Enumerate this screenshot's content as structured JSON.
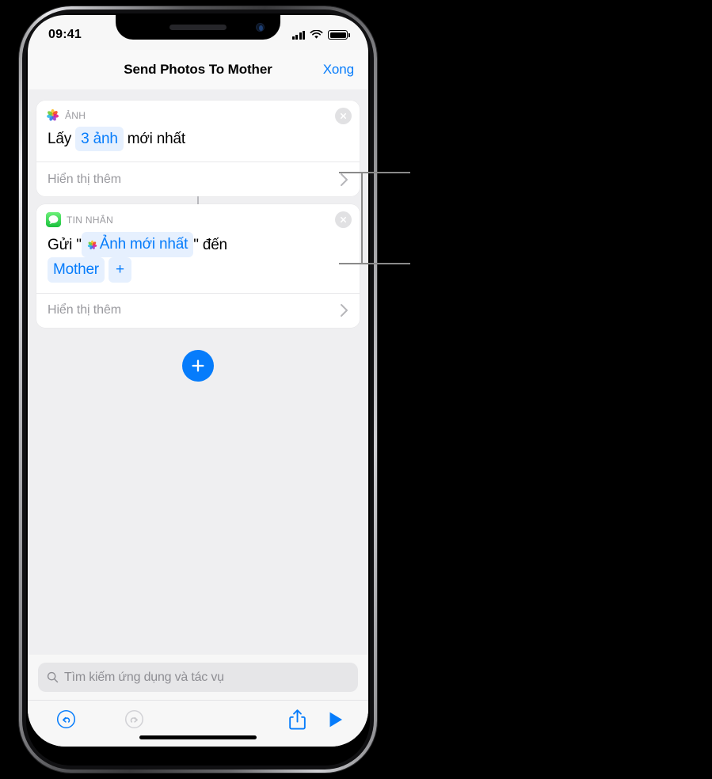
{
  "status_bar": {
    "time": "09:41",
    "signal_icon": "cellular-bars-icon",
    "wifi_icon": "wifi-icon",
    "battery_icon": "battery-icon"
  },
  "nav_bar": {
    "title": "Send Photos To Mother",
    "done_label": "Xong"
  },
  "shortcut": {
    "actions": [
      {
        "app_name": "ẢNH",
        "app_icon": "photos-icon",
        "close_icon": "close-circle-icon",
        "phrase_parts": [
          {
            "type": "text",
            "value": "Lấy"
          },
          {
            "type": "token",
            "value": "3 ảnh"
          },
          {
            "type": "text",
            "value": "mới nhất"
          }
        ],
        "show_more_label": "Hiển thị thêm",
        "chevron_icon": "chevron-right-icon"
      },
      {
        "app_name": "TIN NHẮN",
        "app_icon": "messages-icon",
        "close_icon": "close-circle-icon",
        "phrase_parts": [
          {
            "type": "text",
            "value": "Gửi \""
          },
          {
            "type": "token",
            "value": "Ảnh mới nhất",
            "icon": "photos-icon"
          },
          {
            "type": "text",
            "value": "\" đến"
          },
          {
            "type": "token",
            "value": "Mother"
          },
          {
            "type": "token",
            "value": "+"
          }
        ],
        "show_more_label": "Hiển thị thêm",
        "chevron_icon": "chevron-right-icon"
      }
    ],
    "add_action_icon": "plus-icon"
  },
  "search": {
    "placeholder": "Tìm kiếm ứng dụng và tác vụ",
    "icon": "search-icon"
  },
  "toolbar": {
    "undo_icon": "undo-icon",
    "redo_icon": "redo-icon",
    "share_icon": "share-icon",
    "play_icon": "play-icon"
  },
  "colors": {
    "accent_blue": "#067cfb",
    "token_bg": "#e6f0fe",
    "canvas": "#efeff1",
    "card": "#ffffff",
    "muted_text": "#9a9a9f",
    "messages_green": "#4cd964",
    "disabled_gray": "#c9c9cd"
  }
}
